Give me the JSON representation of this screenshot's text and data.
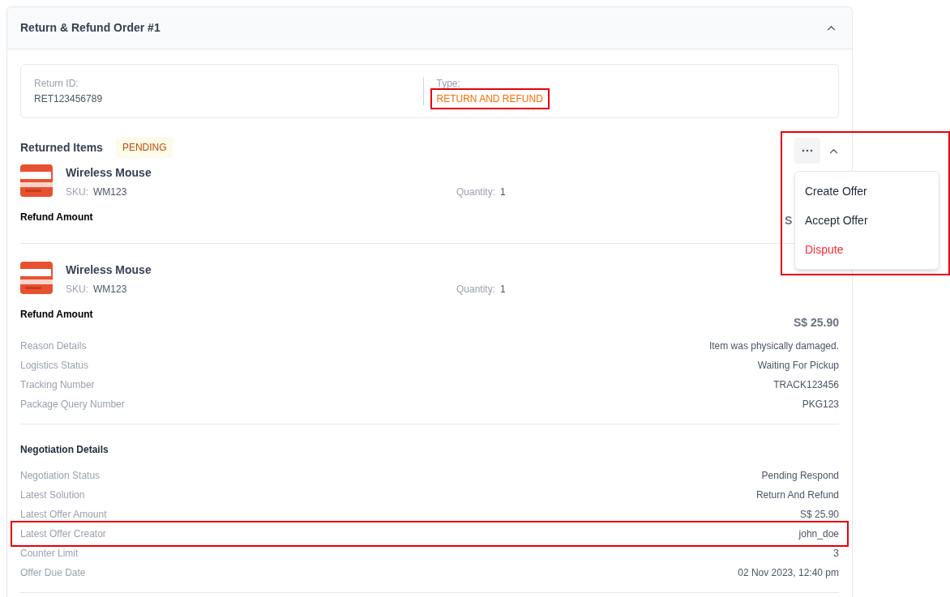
{
  "order": {
    "title": "Return & Refund Order #1",
    "expanded": true
  },
  "info": [
    {
      "label": "Return ID:",
      "value": "RET123456789",
      "kind": "plain",
      "highlighted": false
    },
    {
      "label": "Type:",
      "value": "RETURN AND REFUND",
      "kind": "accent",
      "highlighted": true
    }
  ],
  "returned_items": {
    "title": "Returned Items",
    "status": "PENDING",
    "expanded": true,
    "items": [
      {
        "name": "Wireless Mouse",
        "sku_label": "SKU:",
        "sku": "WM123",
        "quantity_label": "Quantity:",
        "quantity": "1",
        "refund_label": "Refund Amount",
        "refund": "S",
        "covered": true
      },
      {
        "name": "Wireless Mouse",
        "sku_label": "SKU:",
        "sku": "WM123",
        "quantity_label": "Quantity:",
        "quantity": "1",
        "refund_label": "Refund Amount",
        "refund": "S$ 25.90",
        "covered": false
      }
    ]
  },
  "details": [
    {
      "label": "Reason Details",
      "value": "Item was physically damaged."
    },
    {
      "label": "Logistics Status",
      "value": "Waiting For Pickup"
    },
    {
      "label": "Tracking Number",
      "value": "TRACK123456"
    },
    {
      "label": "Package Query Number",
      "value": "PKG123"
    }
  ],
  "negotiation": {
    "title": "Negotiation Details",
    "rows": [
      {
        "label": "Negotiation Status",
        "value": "Pending Respond",
        "highlighted": false
      },
      {
        "label": "Latest Solution",
        "value": "Return And Refund",
        "highlighted": false
      },
      {
        "label": "Latest Offer Amount",
        "value": "S$ 25.90",
        "highlighted": false
      },
      {
        "label": "Latest Offer Creator",
        "value": "john_doe",
        "highlighted": true
      },
      {
        "label": "Counter Limit",
        "value": "3",
        "highlighted": false
      },
      {
        "label": "Offer Due Date",
        "value": "02 Nov 2023, 12:40 pm",
        "highlighted": false
      }
    ]
  },
  "menu": {
    "open": true,
    "highlighted": true,
    "items": [
      {
        "label": "Create Offer",
        "kind": "normal"
      },
      {
        "label": "Accept Offer",
        "kind": "normal"
      },
      {
        "label": "Dispute",
        "kind": "danger"
      }
    ]
  }
}
